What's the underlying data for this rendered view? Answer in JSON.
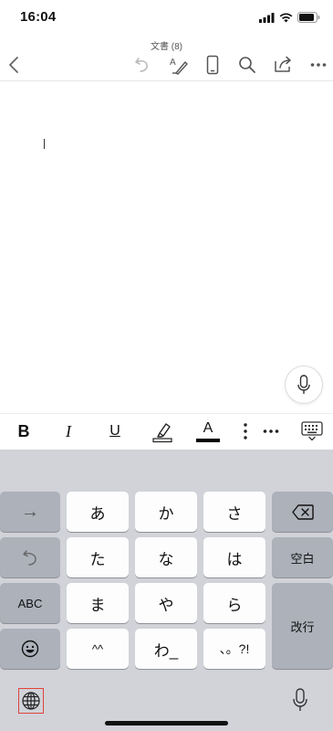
{
  "status": {
    "time": "16:04"
  },
  "nav": {
    "doc_title": "文書 (8)"
  },
  "format_bar": {
    "bold": "B",
    "italic": "I",
    "underline": "U",
    "font_color_letter": "A"
  },
  "keyboard": {
    "rows": [
      [
        "あ",
        "か",
        "さ"
      ],
      [
        "た",
        "な",
        "は"
      ],
      [
        "ま",
        "や",
        "ら"
      ],
      [
        "^^",
        "わ_",
        "、。?!"
      ]
    ],
    "left_keys": {
      "arrow": "→",
      "abc": "ABC"
    },
    "space_label": "空白",
    "return_label": "改行"
  },
  "colors": {
    "font_color_bar": "#000000",
    "keyboard_bg": "#d1d3d9",
    "dark_key": "#acb1ba"
  },
  "icons": [
    "back-chevron-icon",
    "undo-icon",
    "spellcheck-pen-icon",
    "mobile-view-icon",
    "search-icon",
    "share-icon",
    "more-icon",
    "microphone-icon",
    "highlighter-icon",
    "keyboard-hide-icon",
    "backspace-icon",
    "globe-icon",
    "emoji-icon"
  ]
}
